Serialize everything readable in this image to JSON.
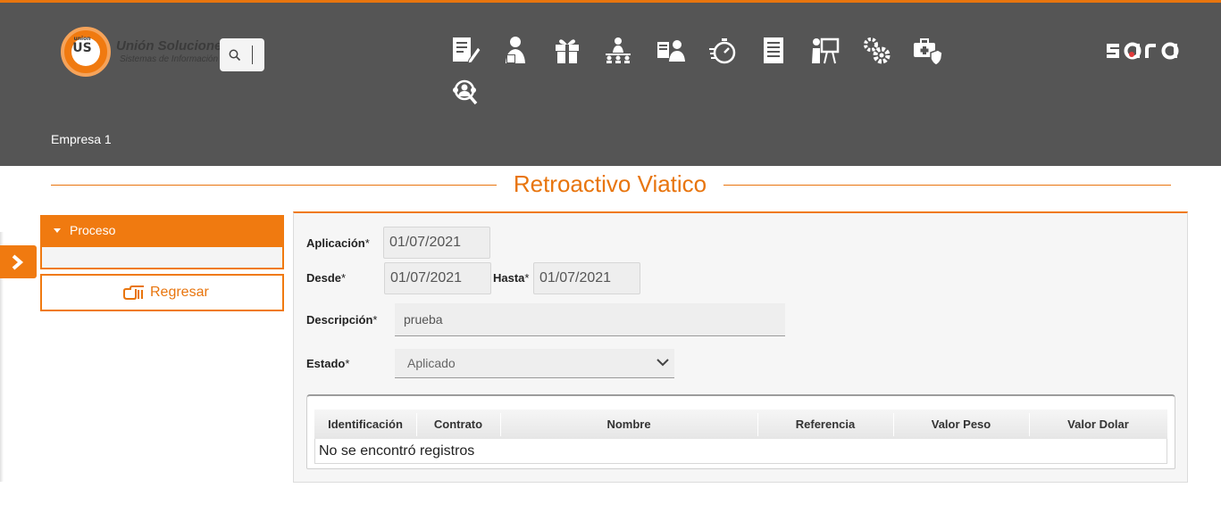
{
  "header": {
    "logo": {
      "small": "union",
      "big": "US",
      "title": "Unión Soluciones",
      "subtitle": "Sistemas de Información"
    },
    "menu_icons": [
      "document-edit-icon",
      "user-document-icon",
      "gift-icon",
      "meeting-icon",
      "id-card-user-icon",
      "stopwatch-icon",
      "report-list-icon",
      "presentation-icon",
      "gears-icon",
      "medical-case-shield-icon",
      "users-search-icon"
    ],
    "brand": "sara",
    "company": "Empresa 1"
  },
  "page": {
    "title": "Retroactivo Viatico"
  },
  "sidebar": {
    "section_label": "Proceso",
    "back_label": "Regresar"
  },
  "form": {
    "aplicacion_label": "Aplicación",
    "aplicacion_value": "01/07/2021",
    "desde_label": "Desde",
    "desde_value": "01/07/2021",
    "hasta_label": "Hasta",
    "hasta_value": "01/07/2021",
    "descripcion_label": "Descripción",
    "descripcion_value": "prueba",
    "estado_label": "Estado",
    "estado_value": "Aplicado",
    "required_mark": "*"
  },
  "table": {
    "columns": [
      "Identificación",
      "Contrato",
      "Nombre",
      "Referencia",
      "Valor Peso",
      "Valor Dolar"
    ],
    "empty_message": "No se encontró registros"
  },
  "colors": {
    "accent": "#f07a10",
    "header_bg": "#555555",
    "title": "#e8750e"
  }
}
